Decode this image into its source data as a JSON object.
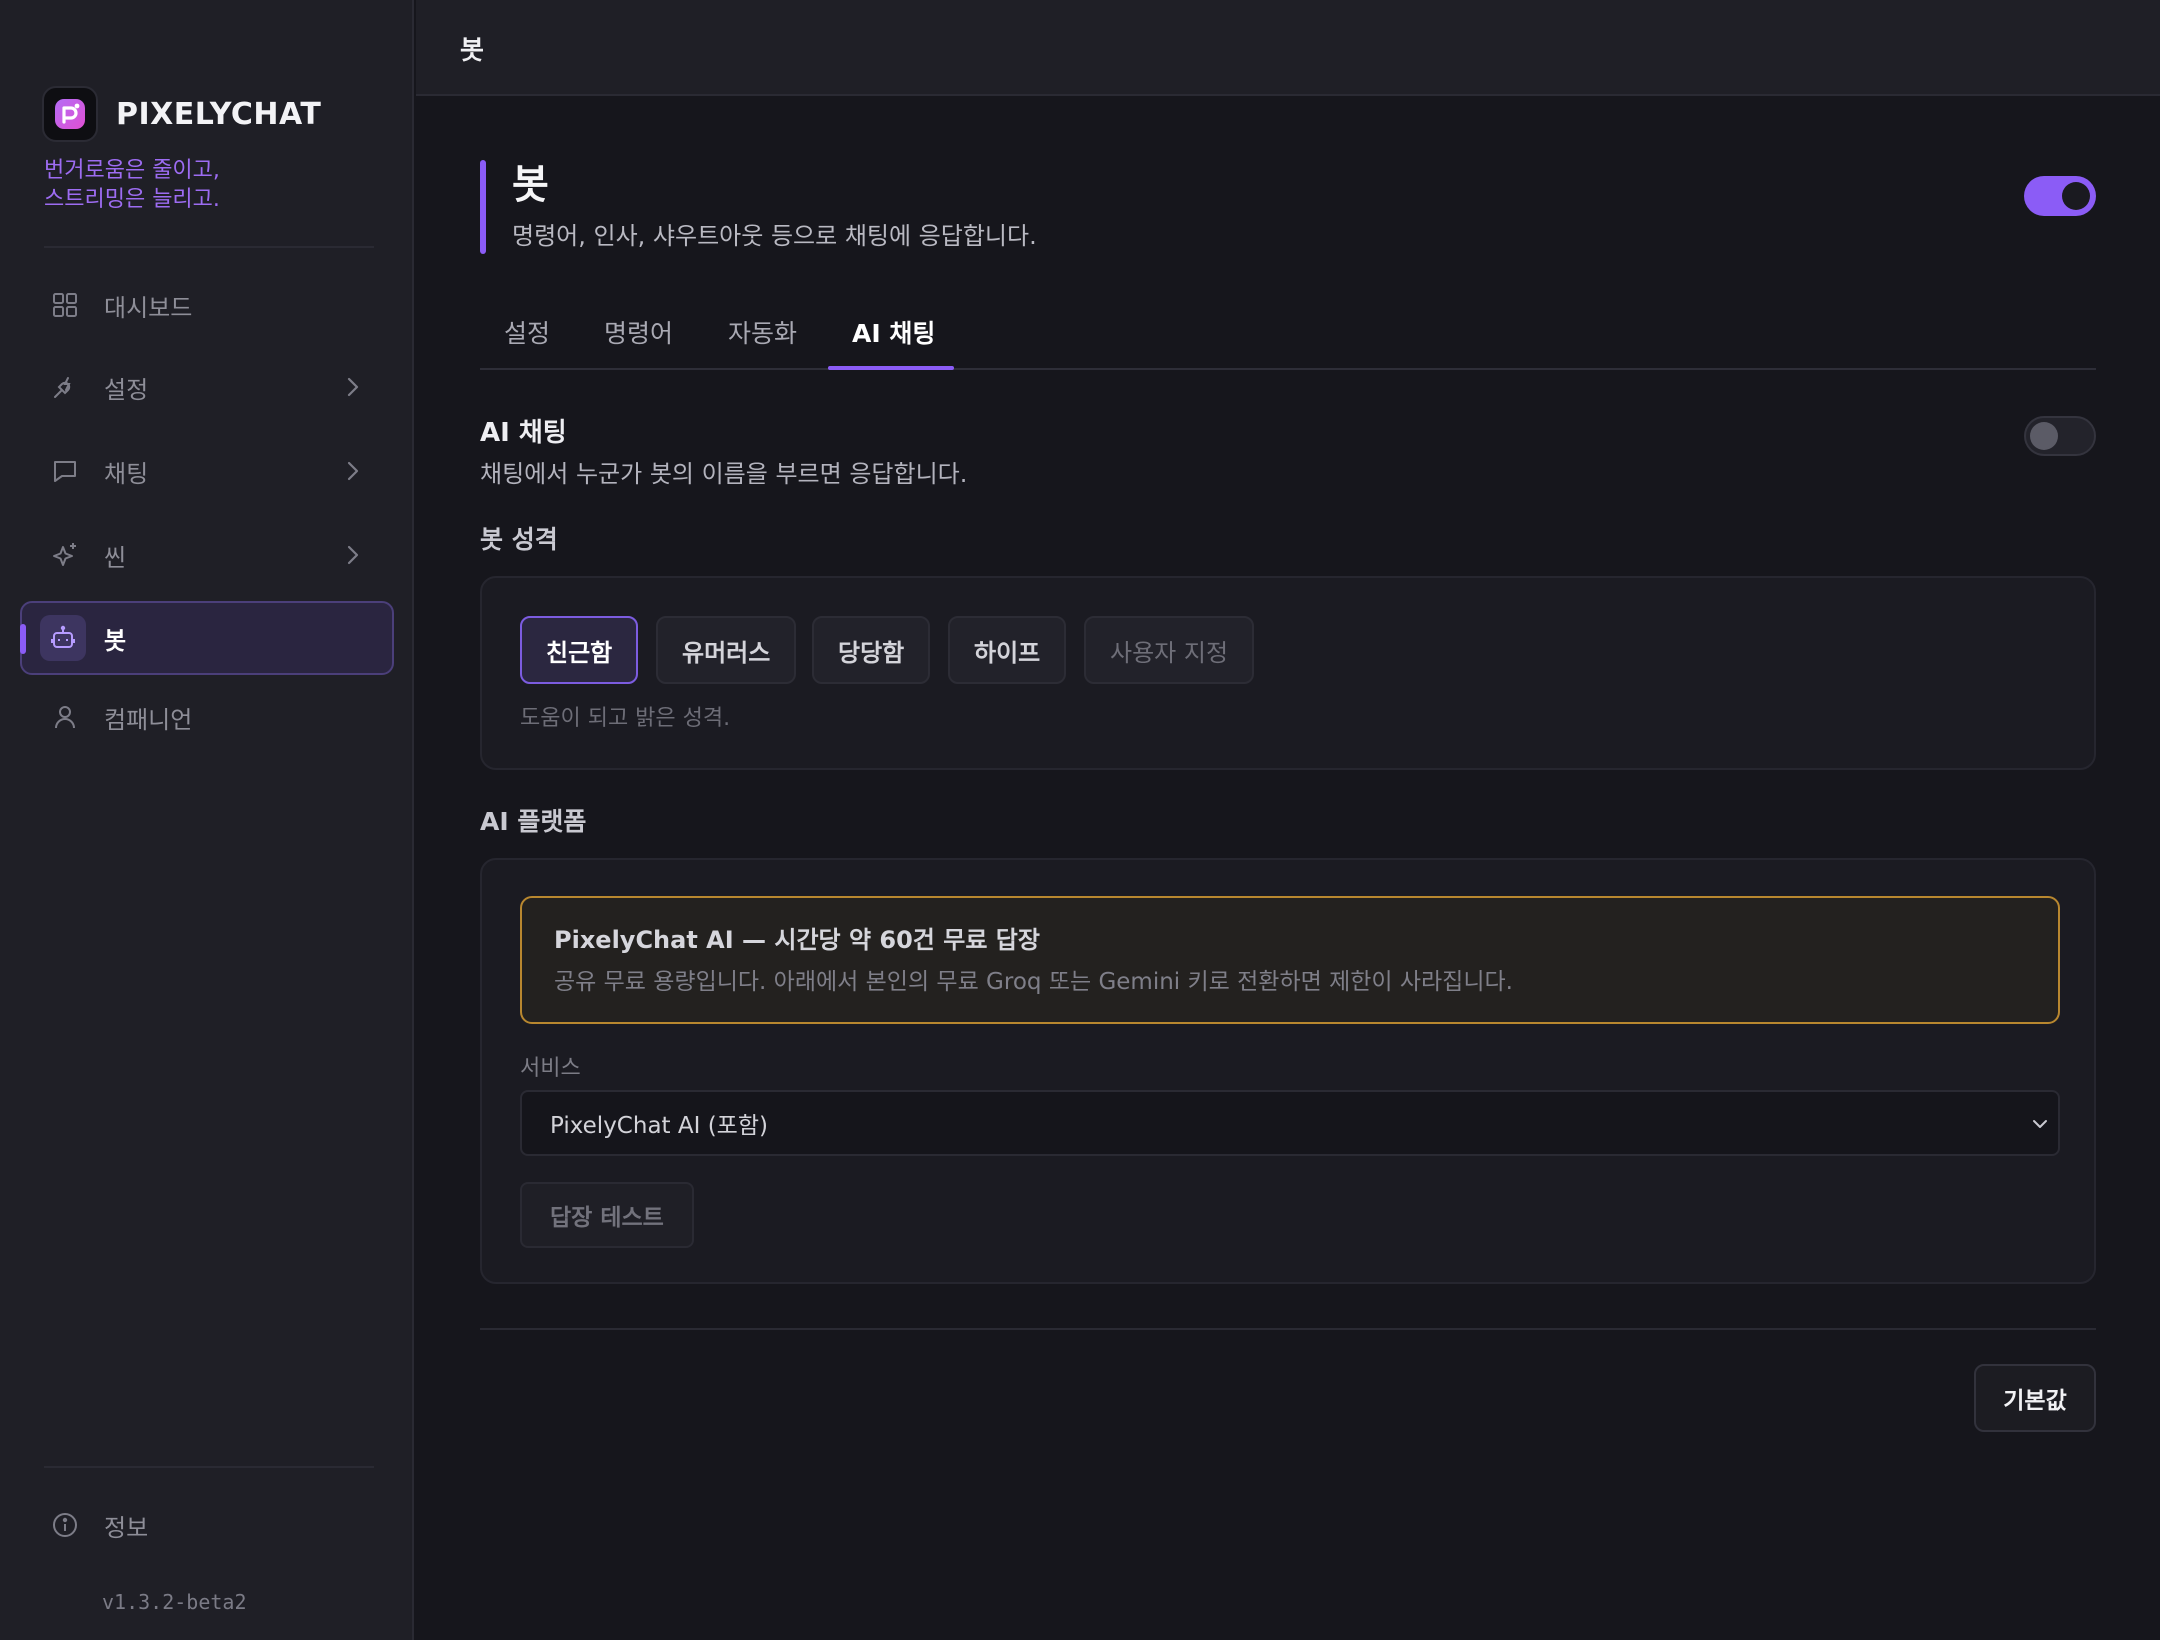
{
  "app": {
    "name": "PIXELYCHAT",
    "tagline_line1": "번거로움은 줄이고,",
    "tagline_line2": "스트리밍은 늘리고.",
    "version": "v1.3.2-beta2",
    "accent_color": "#8b5cf6"
  },
  "sidebar": {
    "items": [
      {
        "label": "대시보드",
        "icon": "grid-icon"
      },
      {
        "label": "설정",
        "icon": "plug-icon",
        "has_submenu": true
      },
      {
        "label": "채팅",
        "icon": "chat-bubble-icon",
        "has_submenu": true
      },
      {
        "label": "씬",
        "icon": "sparkle-icon",
        "has_submenu": true
      },
      {
        "label": "봇",
        "icon": "bot-icon",
        "active": true
      },
      {
        "label": "컴패니언",
        "icon": "user-icon"
      }
    ],
    "footer": {
      "label": "정보",
      "icon": "info-icon"
    }
  },
  "topbar": {
    "title": "봇"
  },
  "page": {
    "title": "봇",
    "subtitle": "명령어, 인사, 샤우트아웃 등으로 채팅에 응답합니다.",
    "enabled": true
  },
  "tabs": [
    "설정",
    "명령어",
    "자동화",
    "AI 채팅"
  ],
  "active_tab": "AI 채팅",
  "ai_chat": {
    "title": "AI 채팅",
    "description": "채팅에서 누군가 봇의 이름을 부르면 응답합니다.",
    "enabled": false
  },
  "personality": {
    "title": "봇 성격",
    "options": [
      "친근함",
      "유머러스",
      "당당함",
      "하이프",
      "사용자 지정"
    ],
    "selected": "친근함",
    "description": "도움이 되고 밝은 성격."
  },
  "platform": {
    "title": "AI 플랫폼",
    "notice_title": "PixelyChat AI — 시간당 약 60건 무료 답장",
    "notice_body": "공유 무료 용량입니다. 아래에서 본인의 무료 Groq 또는 Gemini 키로 전환하면 제한이 사라집니다.",
    "notice_color": "#b8872f",
    "service_label": "서비스",
    "service_value": "PixelyChat AI (포함)",
    "test_button": "답장 테스트"
  },
  "footer_actions": {
    "reset_label": "기본값"
  }
}
